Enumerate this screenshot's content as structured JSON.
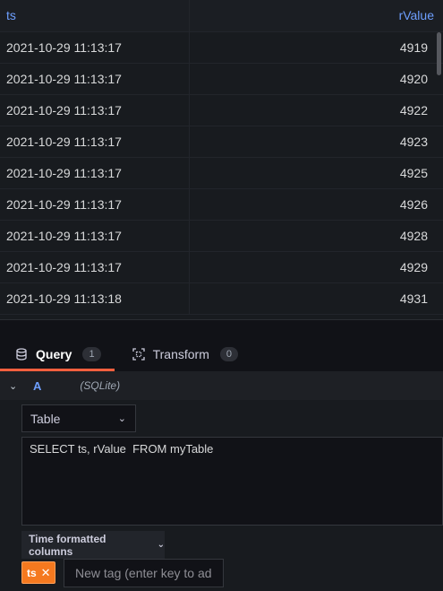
{
  "table": {
    "columns": [
      "ts",
      "rValue"
    ],
    "rows": [
      {
        "ts": "2021-10-29 11:13:17",
        "value": "4919"
      },
      {
        "ts": "2021-10-29 11:13:17",
        "value": "4920"
      },
      {
        "ts": "2021-10-29 11:13:17",
        "value": "4922"
      },
      {
        "ts": "2021-10-29 11:13:17",
        "value": "4923"
      },
      {
        "ts": "2021-10-29 11:13:17",
        "value": "4925"
      },
      {
        "ts": "2021-10-29 11:13:17",
        "value": "4926"
      },
      {
        "ts": "2021-10-29 11:13:17",
        "value": "4928"
      },
      {
        "ts": "2021-10-29 11:13:17",
        "value": "4929"
      },
      {
        "ts": "2021-10-29 11:13:18",
        "value": "4931"
      }
    ]
  },
  "tabs": [
    {
      "label": "Query",
      "count": "1",
      "icon": "database-icon",
      "active": true
    },
    {
      "label": "Transform",
      "count": "0",
      "icon": "transform-icon",
      "active": false
    }
  ],
  "query": {
    "ref": "A",
    "datasource": "(SQLite)",
    "format": "Table",
    "sql": "SELECT ts, rValue  FROM myTable",
    "time_columns_label": "Time formatted columns",
    "tag": "ts",
    "tag_placeholder": "New tag (enter key to add"
  },
  "colors": {
    "accent_blue": "#6e9fff",
    "active_tab": "#f55f3e",
    "tag_orange": "#f5791f"
  }
}
